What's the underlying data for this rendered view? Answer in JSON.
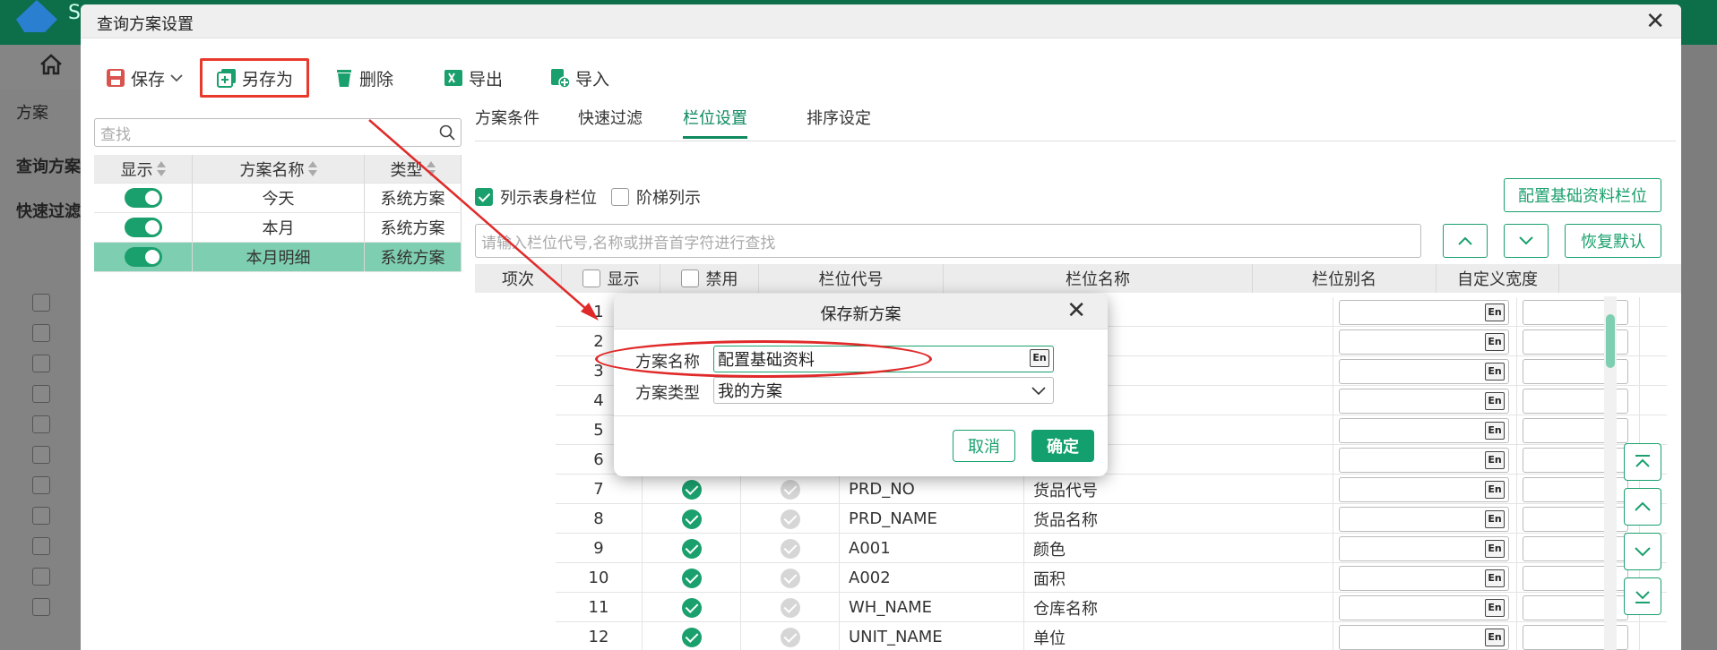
{
  "background": {
    "logo_letter": "S",
    "left_label_1": "方案",
    "left_label_2": "查询方案",
    "left_label_3": "快速过滤"
  },
  "dialog": {
    "title": "查询方案设置",
    "toolbar": {
      "save": "保存",
      "save_as": "另存为",
      "delete": "删除",
      "export": "导出",
      "import": "导入"
    },
    "search_placeholder": "查找",
    "scheme_table": {
      "headers": [
        "显示",
        "方案名称",
        "类型"
      ],
      "rows": [
        {
          "name": "今天",
          "type": "系统方案"
        },
        {
          "name": "本月",
          "type": "系统方案"
        },
        {
          "name": "本月明细",
          "type": "系统方案"
        }
      ]
    },
    "tabs": [
      "方案条件",
      "快速过滤",
      "栏位设置",
      "排序设定"
    ],
    "active_tab": "栏位设置",
    "options": {
      "list_body_columns": "列示表身栏位",
      "ladder_list": "阶梯列示",
      "config_base_btn": "配置基础资料栏位",
      "restore_default_btn": "恢复默认"
    },
    "column_search_placeholder": "请输入栏位代号,名称或拼音首字符进行查找",
    "column_grid": {
      "headers": [
        "项次",
        "显示",
        "禁用",
        "栏位代号",
        "栏位名称",
        "栏位别名",
        "自定义宽度"
      ],
      "rows": [
        {
          "no": "1",
          "code": "",
          "name": ""
        },
        {
          "no": "2",
          "code": "",
          "name": ""
        },
        {
          "no": "3",
          "code": "",
          "name": ""
        },
        {
          "no": "4",
          "code": "",
          "name": ""
        },
        {
          "no": "5",
          "code": "",
          "name": ""
        },
        {
          "no": "6",
          "code": "",
          "name": ""
        },
        {
          "no": "7",
          "code": "PRD_NO",
          "name": "货品代号"
        },
        {
          "no": "8",
          "code": "PRD_NAME",
          "name": "货品名称"
        },
        {
          "no": "9",
          "code": "A001",
          "name": "颜色"
        },
        {
          "no": "10",
          "code": "A002",
          "name": "面积"
        },
        {
          "no": "11",
          "code": "WH_NAME",
          "name": "仓库名称"
        },
        {
          "no": "12",
          "code": "UNIT_NAME",
          "name": "单位"
        }
      ]
    },
    "en_icon": "En"
  },
  "modal": {
    "title": "保存新方案",
    "name_label": "方案名称",
    "name_value": "配置基础资料",
    "type_label": "方案类型",
    "type_value": "我的方案",
    "cancel": "取消",
    "ok": "确定"
  },
  "colors": {
    "accent": "#1aa06d",
    "highlight": "#e8392b"
  }
}
